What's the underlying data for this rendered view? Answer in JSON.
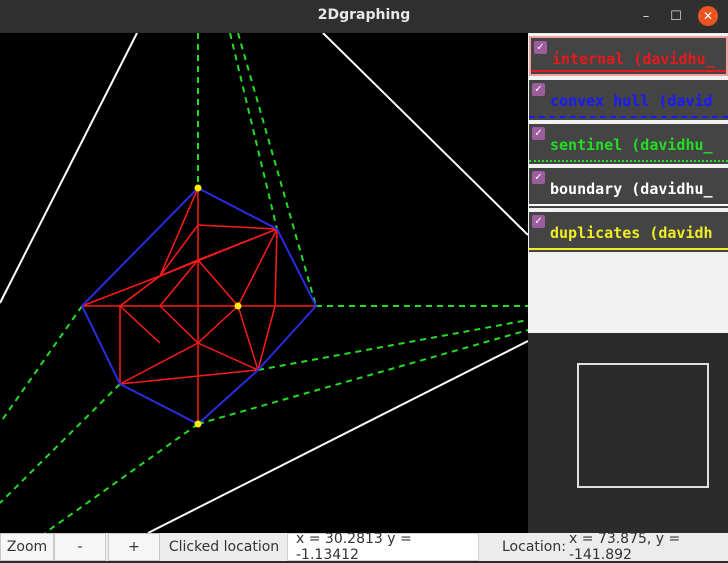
{
  "window": {
    "title": "2Dgraphing"
  },
  "window_controls": {
    "minimize": "–",
    "maximize": "☐",
    "close": "✕"
  },
  "layers": [
    {
      "label": "internal (davidhu_",
      "color": "#e41a1c",
      "checked": "✓"
    },
    {
      "label": "convex hull (david",
      "color": "#1a1aff",
      "checked": "✓"
    },
    {
      "label": "sentinel (davidhu_",
      "color": "#22dd22",
      "checked": "✓"
    },
    {
      "label": "boundary (davidhu_",
      "color": "#ffffff",
      "checked": "✓"
    },
    {
      "label": "duplicates (davidh",
      "color": "#eeee22",
      "checked": "✓"
    }
  ],
  "statusbar": {
    "zoom_label": "Zoom",
    "zoom_out": "-",
    "zoom_in": "+",
    "clicked_label": "Clicked location",
    "clicked_value": "x = 30.2813  y = -1.13412",
    "location_label": "Location:",
    "location_value": "x = 73.875,  y = -141.892"
  },
  "colors": {
    "internal_edge": "#ff1a1a",
    "hull_edge": "#2a2ae0",
    "sentinel_edge": "#22dd22",
    "boundary_edge": "#ffffff",
    "duplicate_point": "#ffee00"
  },
  "icons": {
    "checkbox": "check-icon"
  }
}
